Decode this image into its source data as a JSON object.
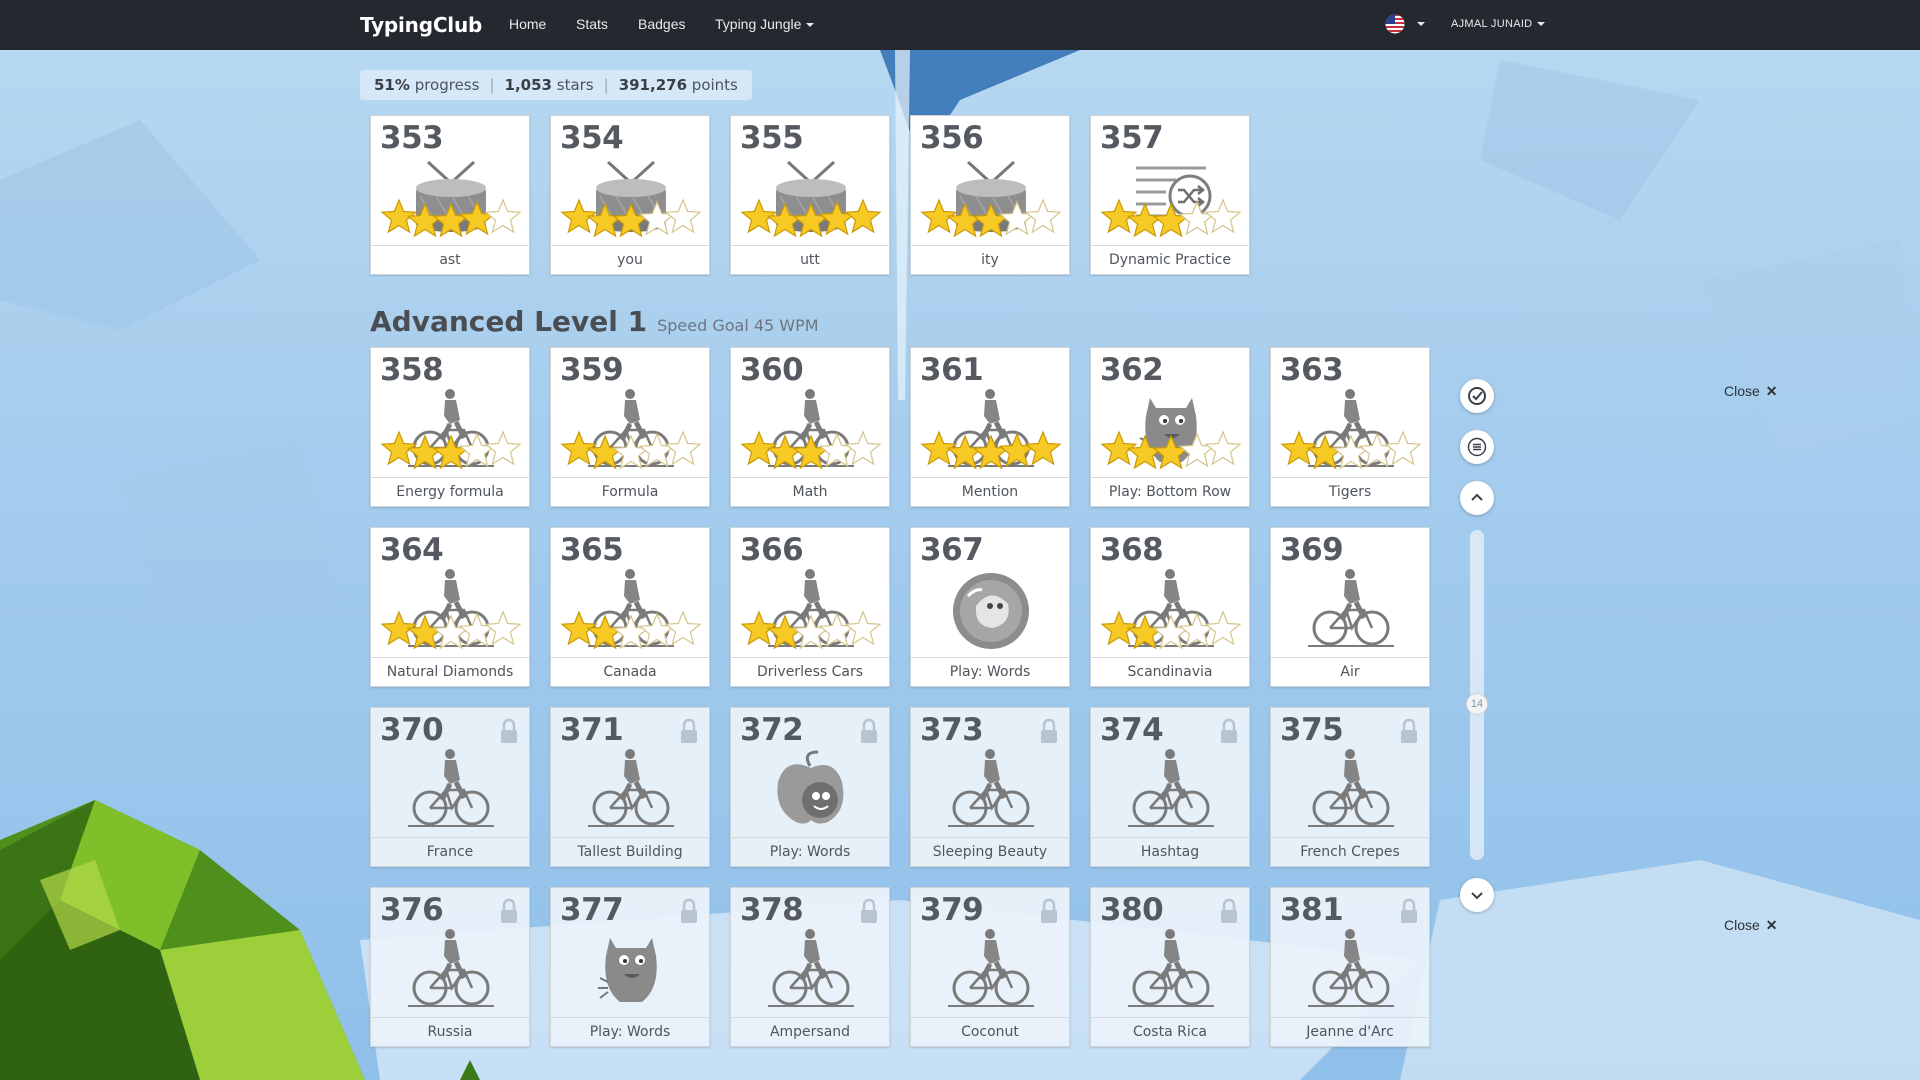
{
  "nav": {
    "brand": "TypingClub",
    "links": [
      "Home",
      "Stats",
      "Badges",
      "Typing Jungle"
    ],
    "user": "AJMAL JUNAID"
  },
  "progress": {
    "percent": "51%",
    "percent_label": "progress",
    "stars": "1,053",
    "stars_label": "stars",
    "points": "391,276",
    "points_label": "points"
  },
  "section": {
    "title": "Advanced Level 1",
    "goal": "Speed Goal 45 WPM"
  },
  "lessons": [
    {
      "num": "353",
      "label": "ast",
      "icon": "drum-icon",
      "stars": 4,
      "locked": false
    },
    {
      "num": "354",
      "label": "you",
      "icon": "drum-icon",
      "stars": 3,
      "locked": false
    },
    {
      "num": "355",
      "label": "utt",
      "icon": "drum-icon",
      "stars": 5,
      "locked": false
    },
    {
      "num": "356",
      "label": "ity",
      "icon": "drum-icon",
      "stars": 3,
      "locked": false
    },
    {
      "num": "357",
      "label": "Dynamic Practice",
      "icon": "shuffle-list-icon",
      "stars": 3,
      "locked": false
    },
    {
      "num": "358",
      "label": "Energy formula",
      "icon": "cyclist-icon",
      "stars": 3,
      "locked": false
    },
    {
      "num": "359",
      "label": "Formula",
      "icon": "cyclist-icon",
      "stars": 2,
      "locked": false
    },
    {
      "num": "360",
      "label": "Math",
      "icon": "cyclist-icon",
      "stars": 3,
      "locked": false
    },
    {
      "num": "361",
      "label": "Mention",
      "icon": "cyclist-icon",
      "stars": 5,
      "locked": false
    },
    {
      "num": "362",
      "label": "Play: Bottom Row",
      "icon": "monster-icon",
      "stars": 3,
      "locked": false
    },
    {
      "num": "363",
      "label": "Tigers",
      "icon": "cyclist-icon",
      "stars": 2,
      "locked": false
    },
    {
      "num": "364",
      "label": "Natural Diamonds",
      "icon": "cyclist-icon",
      "stars": 2,
      "locked": false
    },
    {
      "num": "365",
      "label": "Canada",
      "icon": "cyclist-icon",
      "stars": 2,
      "locked": false
    },
    {
      "num": "366",
      "label": "Driverless Cars",
      "icon": "cyclist-icon",
      "stars": 2,
      "locked": false
    },
    {
      "num": "367",
      "label": "Play: Words",
      "icon": "bubble-game-icon",
      "stars": 0,
      "locked": false
    },
    {
      "num": "368",
      "label": "Scandinavia",
      "icon": "cyclist-icon",
      "stars": 2,
      "locked": false
    },
    {
      "num": "369",
      "label": "Air",
      "icon": "cyclist-icon",
      "stars": 0,
      "locked": false
    },
    {
      "num": "370",
      "label": "France",
      "icon": "cyclist-icon",
      "stars": 0,
      "locked": true
    },
    {
      "num": "371",
      "label": "Tallest Building",
      "icon": "cyclist-icon",
      "stars": 0,
      "locked": true
    },
    {
      "num": "372",
      "label": "Play: Words",
      "icon": "apple-game-icon",
      "stars": 0,
      "locked": true
    },
    {
      "num": "373",
      "label": "Sleeping Beauty",
      "icon": "cyclist-icon",
      "stars": 0,
      "locked": true
    },
    {
      "num": "374",
      "label": "Hashtag",
      "icon": "cyclist-icon",
      "stars": 0,
      "locked": true
    },
    {
      "num": "375",
      "label": "French Crepes",
      "icon": "cyclist-icon",
      "stars": 0,
      "locked": true
    },
    {
      "num": "376",
      "label": "Russia",
      "icon": "cyclist-icon",
      "stars": 0,
      "locked": true
    },
    {
      "num": "377",
      "label": "Play: Words",
      "icon": "monster-icon",
      "stars": 0,
      "locked": true
    },
    {
      "num": "378",
      "label": "Ampersand",
      "icon": "cyclist-icon",
      "stars": 0,
      "locked": true
    },
    {
      "num": "379",
      "label": "Coconut",
      "icon": "cyclist-icon",
      "stars": 0,
      "locked": true
    },
    {
      "num": "380",
      "label": "Costa Rica",
      "icon": "cyclist-icon",
      "stars": 0,
      "locked": true
    },
    {
      "num": "381",
      "label": "Jeanne d'Arc",
      "icon": "cyclist-icon",
      "stars": 0,
      "locked": true
    }
  ],
  "scroller": {
    "position_label": "14",
    "icons": [
      "check-circle-icon",
      "menu-icon",
      "chevron-up-icon",
      "chevron-down-icon"
    ]
  },
  "close_label": "Close",
  "colors": {
    "navbar": "#24292f",
    "star_fill": "#f7c925",
    "icon_gray": "#8c8c8c"
  }
}
